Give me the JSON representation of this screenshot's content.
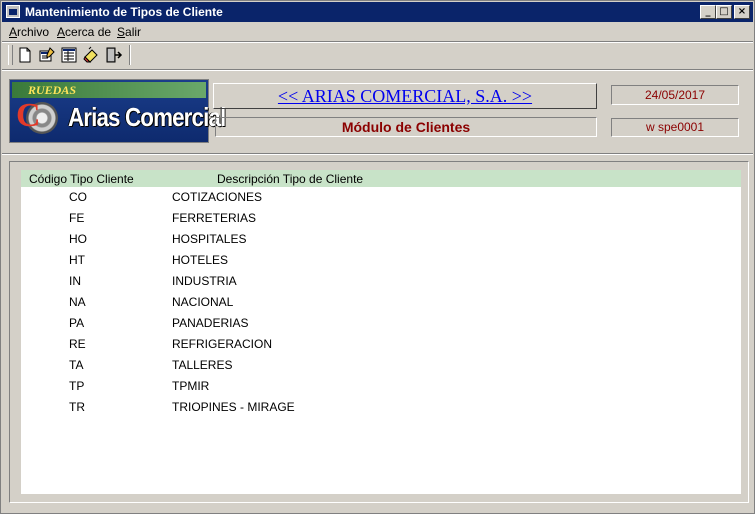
{
  "window": {
    "title": "Mantenimiento de Tipos de Cliente",
    "controls": {
      "minimize": "_",
      "maximize": "□",
      "close": "×"
    }
  },
  "menu": {
    "items": [
      {
        "underline": "A",
        "rest": "rchivo"
      },
      {
        "underline": "A",
        "rest": "cerca de"
      },
      {
        "underline": "S",
        "rest": "alir"
      }
    ]
  },
  "toolbar": {
    "icons": [
      "new-document-icon",
      "edit-form-icon",
      "list-view-icon",
      "eraser-icon",
      "exit-door-icon"
    ]
  },
  "header": {
    "logo_ruedas": "RUEDAS",
    "logo_letter": "C",
    "logo_name": "Arias Comercial",
    "company": "<< ARIAS COMERCIAL, S.A. >>",
    "module": "Módulo de Clientes",
    "date": "24/05/2017",
    "user": "w  spe0001"
  },
  "colors": {
    "titlebar": "#0a246a",
    "window_bg": "#d4d0c8",
    "list_header_bg": "#c8e3c8",
    "accent_red": "#8b0000",
    "link_blue": "#0000ee"
  },
  "list": {
    "columns": [
      "Código Tipo Cliente",
      "Descripción Tipo de Cliente"
    ],
    "rows": [
      {
        "code": "CO",
        "desc": "COTIZACIONES"
      },
      {
        "code": "FE",
        "desc": "FERRETERIAS"
      },
      {
        "code": "HO",
        "desc": "HOSPITALES"
      },
      {
        "code": "HT",
        "desc": "HOTELES"
      },
      {
        "code": "IN",
        "desc": "INDUSTRIA"
      },
      {
        "code": "NA",
        "desc": "NACIONAL"
      },
      {
        "code": "PA",
        "desc": "PANADERIAS"
      },
      {
        "code": "RE",
        "desc": "REFRIGERACION"
      },
      {
        "code": "TA",
        "desc": "TALLERES"
      },
      {
        "code": "TP",
        "desc": "TPMIR"
      },
      {
        "code": "TR",
        "desc": "TRIOPINES - MIRAGE"
      }
    ]
  }
}
